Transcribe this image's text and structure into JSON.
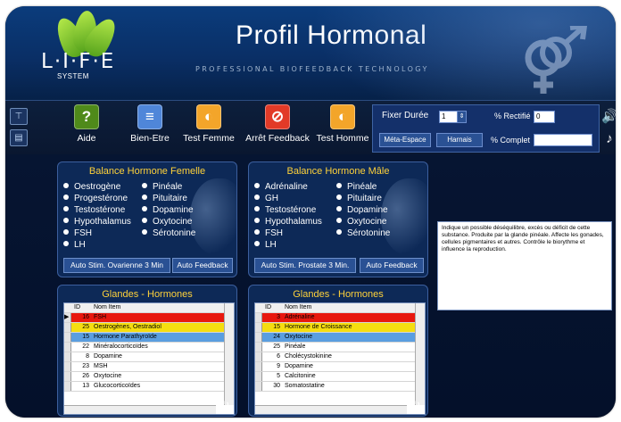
{
  "app": {
    "title": "Profil Hormonal",
    "tagline": "PROFESSIONAL BIOFEEDBACK TECHNOLOGY",
    "logo_text": "L·I·F·E",
    "logo_sub": "SYSTEM"
  },
  "toolbar": {
    "buttons": [
      {
        "label": "Aide",
        "glyph": "?",
        "color": "#4f8a1a",
        "icon": "help-icon"
      },
      {
        "label": "Bien-Etre",
        "glyph": "≡",
        "color": "#4f86d9",
        "icon": "document-icon"
      },
      {
        "label": "Test Femme",
        "glyph": "◐",
        "color": "#f3a52a",
        "icon": "female-head-icon"
      },
      {
        "label": "Arrêt Feedback",
        "glyph": "⊘",
        "color": "#e23a27",
        "icon": "stop-icon"
      },
      {
        "label": "Test Homme",
        "glyph": "◐",
        "color": "#f3a52a",
        "icon": "male-head-icon"
      }
    ],
    "side_buttons": [
      {
        "glyph": "⊤",
        "icon": "antenna-icon"
      },
      {
        "glyph": "▤",
        "icon": "chat-icon"
      }
    ],
    "controls": {
      "fixer_duree_label": "Fixer Durée",
      "fixer_duree_value": "1",
      "rectifie_label": "% Rectifié",
      "rectifie_value": "0",
      "meta_espace_label": "Méta-Espace",
      "harnais_label": "Harnais",
      "complet_label": "% Complet",
      "complet_value": ""
    },
    "speaker_glyph": "🔊",
    "music_glyph": "♪"
  },
  "balance_femelle": {
    "title": "Balance Hormone Femelle",
    "col1": [
      "Oestrogène",
      "Progestérone",
      "Testostérone",
      "Hypothalamus",
      "FSH",
      "LH"
    ],
    "col2": [
      "Pinéale",
      "Pituitaire",
      "Dopamine",
      "Oxytocine",
      "Sérotonine"
    ],
    "btn_left": "Auto Stim. Ovarienne 3 Min",
    "btn_right": "Auto Feedback"
  },
  "balance_male": {
    "title": "Balance Hormone Mâle",
    "col1": [
      "Adrénaline",
      "GH",
      "Testostérone",
      "Hypothalamus",
      "FSH",
      "LH"
    ],
    "col2": [
      "Pinéale",
      "Pituitaire",
      "Dopamine",
      "Oxytocine",
      "Sérotonine"
    ],
    "btn_left": "Auto Stim. Prostate 3 Min.",
    "btn_right": "Auto Feedback"
  },
  "info_text": "Indique un possible déséquilibre, excès ou déficit de cette substance. Produite par la glande pinéale. Affecte les gonades, cellules pigmentaires et autres. Contrôle le biorythme et influence la reproduction.",
  "glandes_femelle": {
    "title": "Glandes - Hormones",
    "col_id": "ID",
    "col_name": "Nom Item",
    "rows": [
      {
        "id": "16",
        "name": "FSH",
        "bg": "#e8180e"
      },
      {
        "id": "25",
        "name": "Oestrogènes, Oestradiol",
        "bg": "#f5dd10"
      },
      {
        "id": "15",
        "name": "Hormone Parathyroïde",
        "bg": "#5a9ee0"
      },
      {
        "id": "22",
        "name": "Minéralocorticoïdes",
        "bg": "#ffffff"
      },
      {
        "id": "8",
        "name": "Dopamine",
        "bg": "#ffffff"
      },
      {
        "id": "23",
        "name": "MSH",
        "bg": "#ffffff"
      },
      {
        "id": "26",
        "name": "Oxytocine",
        "bg": "#ffffff"
      },
      {
        "id": "13",
        "name": "Glucocorticoïdes",
        "bg": "#ffffff"
      }
    ]
  },
  "glandes_male": {
    "title": "Glandes - Hormones",
    "col_id": "ID",
    "col_name": "Nom Item",
    "rows": [
      {
        "id": "3",
        "name": "Adrénaline",
        "bg": "#e8180e"
      },
      {
        "id": "15",
        "name": "Hormone de Croissance",
        "bg": "#f5dd10"
      },
      {
        "id": "24",
        "name": "Oxytocine",
        "bg": "#5a9ee0"
      },
      {
        "id": "25",
        "name": "Pinéale",
        "bg": "#ffffff"
      },
      {
        "id": "6",
        "name": "Cholécystokinine",
        "bg": "#ffffff"
      },
      {
        "id": "9",
        "name": "Dopamine",
        "bg": "#ffffff"
      },
      {
        "id": "5",
        "name": "Calcitonine",
        "bg": "#ffffff"
      },
      {
        "id": "30",
        "name": "Somatostatine",
        "bg": "#ffffff"
      }
    ]
  },
  "refresh_glyph": "↻"
}
